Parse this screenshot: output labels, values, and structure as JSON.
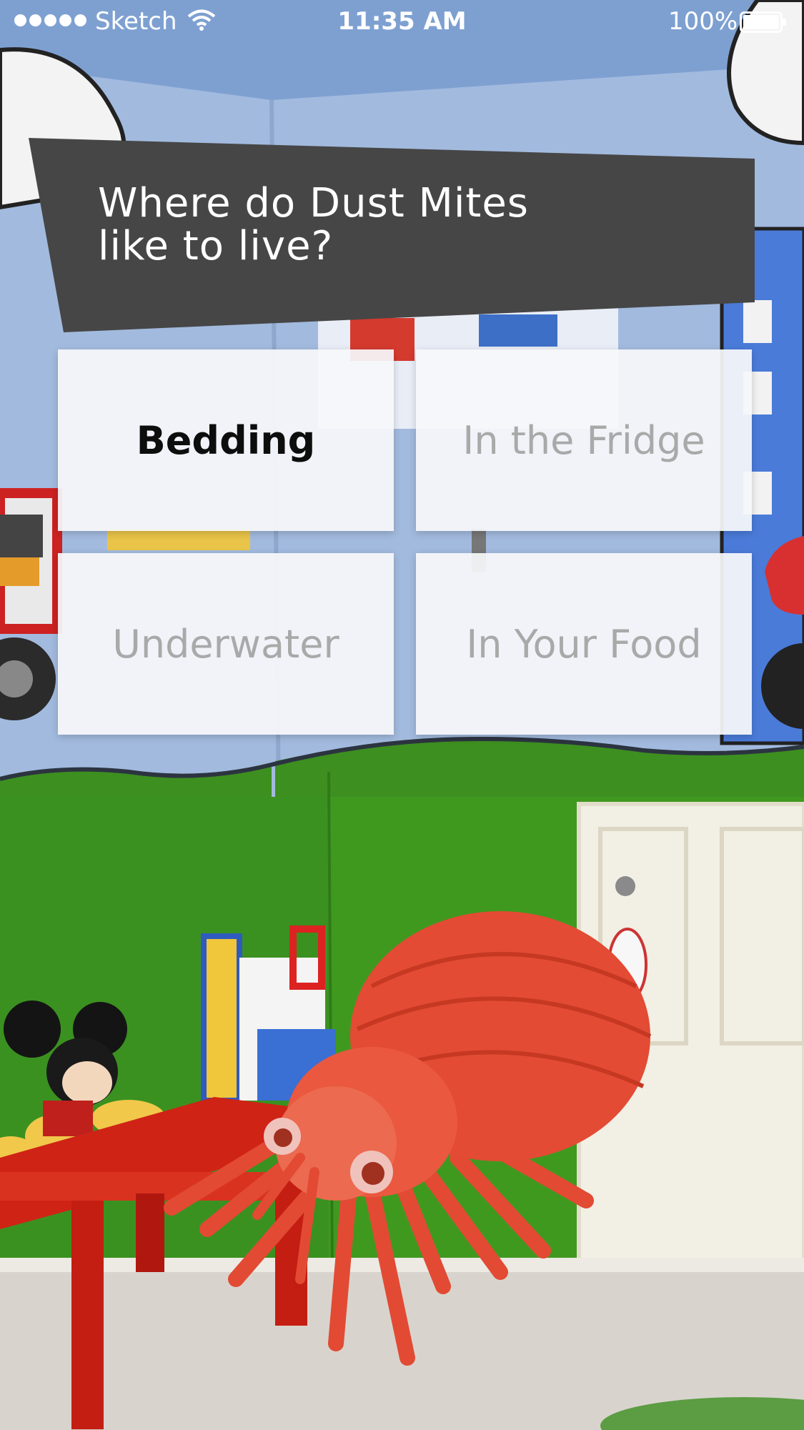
{
  "status_bar": {
    "carrier": "Sketch",
    "time": "11:35 AM",
    "battery": "100%"
  },
  "question": {
    "line1": "Where do Dust Mites",
    "line2": "like to live?"
  },
  "answers": [
    {
      "label": "Bedding",
      "selected": true
    },
    {
      "label": "In the Fridge",
      "selected": false
    },
    {
      "label": "Underwater",
      "selected": false
    },
    {
      "label": "In Your Food",
      "selected": false
    }
  ],
  "colors": {
    "banner": "#464646",
    "wall_blue": "#9fb8dc",
    "wall_green": "#3f9a22",
    "mite_red": "#e24a34",
    "table_red": "#cf2316"
  },
  "icons": [
    "signal-dots-icon",
    "wifi-icon",
    "battery-icon"
  ]
}
